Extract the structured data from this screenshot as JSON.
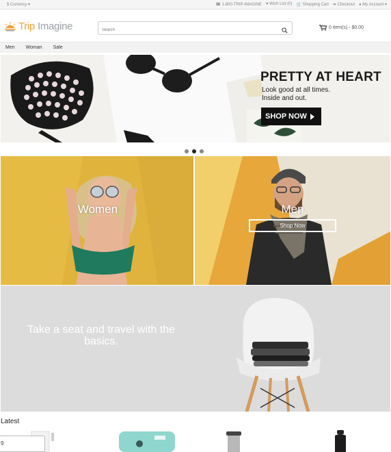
{
  "topbar": {
    "currency": "$ Currency",
    "phone": "1-800-TRIP-IMAGINE",
    "wishlist": "Wish List (0)",
    "shopping_cart": "Shopping Cart",
    "checkout": "Checkout",
    "my_account": "My Account"
  },
  "header": {
    "logo_part1": "Trip",
    "logo_part2": " Imagine",
    "search_placeholder": "Search",
    "cart_text": "0 item(s) - $0.00"
  },
  "nav": {
    "items": [
      "Men",
      "Woman",
      "Sale"
    ]
  },
  "banner": {
    "headline": "PRETTY AT HEART",
    "sub_line1": "Look good at all times.",
    "sub_line2": "Inside and out.",
    "button": "SHOP NOW",
    "slides": 3,
    "active_slide": 2
  },
  "categories": {
    "women_label": "Women",
    "men_label": "Men",
    "men_button": "Shop Now"
  },
  "promo": {
    "text": "Take a seat and travel with the basics."
  },
  "latest": {
    "title": "Latest",
    "tooltip_value": "9"
  },
  "colors": {
    "accent": "#f0a23a",
    "women_bg": "#e2b73f",
    "men_bg": "#e9a83a",
    "promo_bg": "#dcdcdc"
  }
}
